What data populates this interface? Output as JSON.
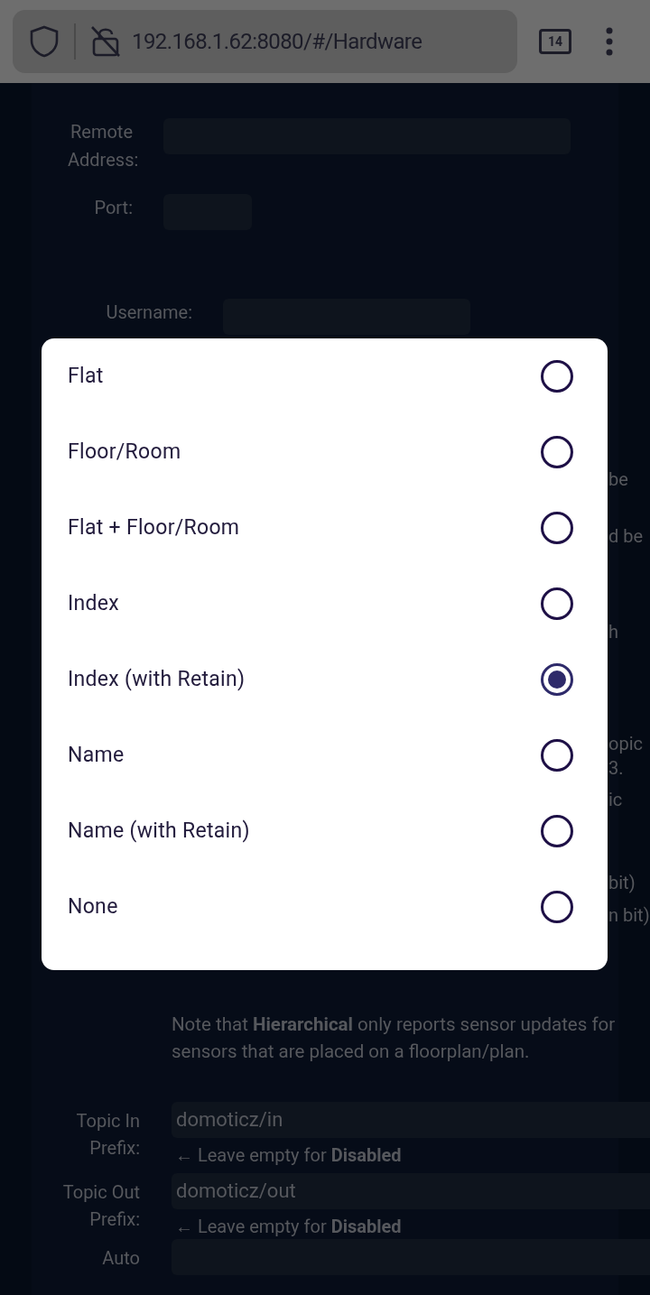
{
  "browser": {
    "url": "192.168.1.62:8080/#/Hardware",
    "tab_count": "14"
  },
  "top_fields": [
    {
      "label": "Remote Address:",
      "kind": "wide"
    },
    {
      "label": "Port:",
      "kind": "short"
    },
    {
      "label": "Username:",
      "kind": "medium"
    }
  ],
  "hidden_text_fragments": [
    "be",
    "d be",
    "h",
    "opic",
    "3.",
    "ic",
    "bit)",
    "n bit)"
  ],
  "dialog": {
    "options": [
      {
        "label": "Flat",
        "selected": false
      },
      {
        "label": "Floor/Room",
        "selected": false
      },
      {
        "label": "Flat + Floor/Room",
        "selected": false
      },
      {
        "label": "Index",
        "selected": false
      },
      {
        "label": "Index (with Retain)",
        "selected": true
      },
      {
        "label": "Name",
        "selected": false
      },
      {
        "label": "Name (with Retain)",
        "selected": false
      },
      {
        "label": "None",
        "selected": false
      }
    ]
  },
  "note": "Note that **Hierarchical** only reports sensor updates for sensors that are placed on a floorplan/plan.",
  "prefix_fields": [
    {
      "label": "Topic In Prefix:",
      "value": "domoticz/in",
      "hint": "← Leave empty for **Disabled**"
    },
    {
      "label": "Topic Out Prefix:",
      "value": "domoticz/out",
      "hint": "← Leave empty for **Disabled**"
    }
  ],
  "auto_discovery_label": "Auto"
}
